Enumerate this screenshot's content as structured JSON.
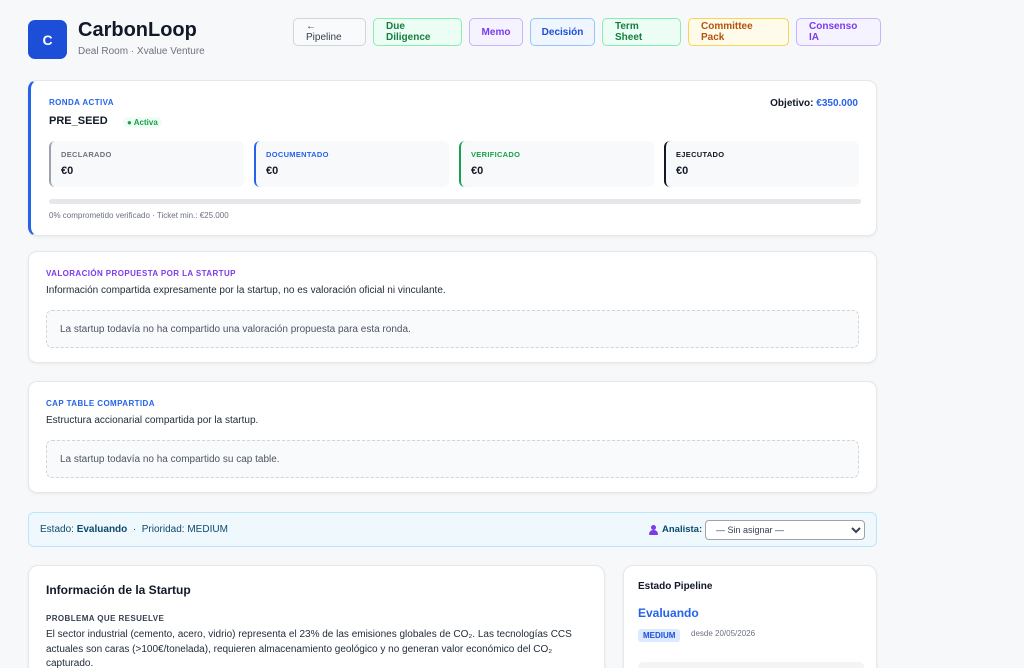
{
  "brand": {
    "logo_letter": "C",
    "name": "CarbonLoop",
    "subtitle": "Deal Room · Xvalue Venture"
  },
  "nav": {
    "pipeline": "← Pipeline",
    "due_diligence": "Due Diligence",
    "memo": "Memo",
    "decision": "Decisión",
    "term_sheet": "Term Sheet",
    "committee_pack": "Committee Pack",
    "consenso_ia": "Consenso IA"
  },
  "ronda": {
    "label": "RONDA ACTIVA",
    "name": "PRE_SEED",
    "status": "● Activa",
    "objetivo_label": "Objetivo:",
    "objetivo_value": "€350.000",
    "metrics": [
      {
        "label": "DECLARADO",
        "value": "€0"
      },
      {
        "label": "DOCUMENTADO",
        "value": "€0"
      },
      {
        "label": "VERIFICADO",
        "value": "€0"
      },
      {
        "label": "EJECUTADO",
        "value": "€0"
      }
    ],
    "progress_fraction": 0,
    "footer": "0% comprometido verificado · Ticket min.: €25.000"
  },
  "valoracion": {
    "label": "VALORACIÓN PROPUESTA POR LA STARTUP",
    "description": "Información compartida expresamente por la startup, no es valoración oficial ni vinculante.",
    "empty": "La startup todavía no ha compartido una valoración propuesta para esta ronda."
  },
  "cap_table": {
    "label": "CAP TABLE COMPARTIDA",
    "description": "Estructura accionarial compartida por la startup.",
    "empty": "La startup todavía no ha compartido su cap table."
  },
  "status_bar": {
    "estado_label": "Estado:",
    "estado_value": "Evaluando",
    "separator": "·",
    "prioridad_label": "Prioridad:",
    "prioridad_value": "MEDIUM",
    "analista_label": "Analista:",
    "analista_selected": "— Sin asignar —"
  },
  "startup_info": {
    "title": "Información de la Startup",
    "problem_label": "PROBLEMA QUE RESUELVE",
    "problem_text": "El sector industrial (cemento, acero, vidrio) representa el 23% de las emisiones globales de CO₂. Las tecnologías CCS actuales son caras (>100€/tonelada), requieren almacenamiento geológico y no generan valor económico del CO₂ capturado."
  },
  "pipeline": {
    "title": "Estado Pipeline",
    "state": "Evaluando",
    "priority": "MEDIUM",
    "since": "desde 20/05/2026"
  }
}
